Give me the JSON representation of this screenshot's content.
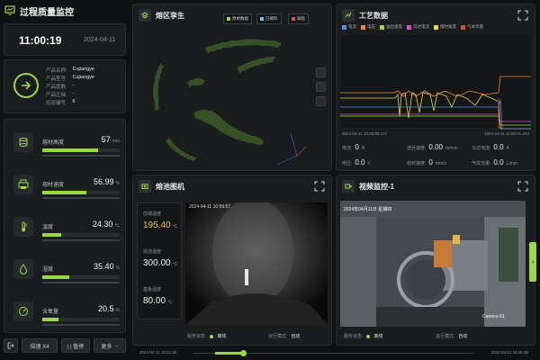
{
  "header": {
    "title": "过程质量监控"
  },
  "time": {
    "clock": "11:00:19",
    "date": "2024-04-11"
  },
  "product": {
    "rows": [
      {
        "label": "产品名称:",
        "value": "Cujiangye"
      },
      {
        "label": "产品型号:",
        "value": "Cujiangye"
      },
      {
        "label": "产品层数:",
        "value": "-"
      },
      {
        "label": "产品区域:",
        "value": "-"
      },
      {
        "label": "控道编号:",
        "value": "6"
      }
    ]
  },
  "metrics": [
    {
      "label": "熔材高度",
      "value": "57",
      "unit": "mm",
      "progress": 0.72,
      "icon": "cylinder-icon"
    },
    {
      "label": "熔材速度",
      "value": "56.99",
      "unit": "%",
      "progress": 0.57,
      "icon": "printer-icon"
    },
    {
      "label": "温度",
      "value": "24.30",
      "unit": "℃",
      "progress": 0.24,
      "icon": "thermometer-icon"
    },
    {
      "label": "湿度",
      "value": "35.40",
      "unit": "%",
      "progress": 0.35,
      "icon": "humidity-icon"
    },
    {
      "label": "含氧量",
      "value": "20.5",
      "unit": "%",
      "progress": 0.21,
      "icon": "gauge-icon"
    }
  ],
  "buttons": {
    "exit": "",
    "speed": "倍速 X4",
    "pause": "| | 暂停",
    "more": "更多"
  },
  "cloud": {
    "title": "熔区孪生",
    "toggles": [
      {
        "label": "原始数据",
        "color": "#9ad84a"
      },
      {
        "label": "已填料",
        "color": "#6fc7e8"
      },
      {
        "label": "缺陷",
        "color": "#e05050"
      }
    ]
  },
  "process": {
    "title": "工艺数据",
    "legend": [
      {
        "label": "电流",
        "color": "#4d8ef0"
      },
      {
        "label": "电压",
        "color": "#f08a3c"
      },
      {
        "label": "送丝速度",
        "color": "#9ad84a"
      },
      {
        "label": "马达电流",
        "color": "#d94bd9"
      },
      {
        "label": "熔材速度",
        "color": "#e7d74a"
      },
      {
        "label": "气体流量",
        "color": "#e04848"
      }
    ],
    "t_start": "2024-04-11 10:59:55.147",
    "t_end": "2024-04-11 11:00:01.243",
    "values": [
      {
        "label": "电流:",
        "value": "0",
        "unit": "A"
      },
      {
        "label": "送丝速度:",
        "value": "0.00",
        "unit": "m/min"
      },
      {
        "label": "马达电流:",
        "value": "0.0",
        "unit": "A"
      },
      {
        "label": "电压:",
        "value": "0.0",
        "unit": "V"
      },
      {
        "label": "熔材速度:",
        "value": "0",
        "unit": "mm/s"
      },
      {
        "label": "气体流量:",
        "value": "0.0",
        "unit": "L/min"
      }
    ]
  },
  "melt": {
    "title": "熔池图机",
    "timestamp": "2024-04-11 10:59:57",
    "readings": [
      {
        "label": "前端温度",
        "value": "195.40",
        "unit": "℃"
      },
      {
        "label": "熔池温度",
        "value": "300.00",
        "unit": "℃"
      },
      {
        "label": "基板温度",
        "value": "80.00",
        "unit": "℃"
      }
    ],
    "status_label": "服务状态:",
    "status_value": "离线",
    "mode_label": "运行模式:",
    "mode_value": "自动"
  },
  "video": {
    "title": "视频监控-1",
    "overlay_date": "2024年04月11日",
    "overlay_day": "星期四",
    "overlay_cam": "Camera 01",
    "status_label": "服务状态:",
    "status_value": "离线",
    "mode_label": "运行模式:",
    "mode_value": "自动"
  },
  "timeline": {
    "start": "2024-04-11 10:11:16",
    "end": "2024-04-11 16:48:35"
  },
  "colors": {
    "accent": "#9ad84a",
    "panel": "#1a1c1e",
    "background": "#101112"
  }
}
